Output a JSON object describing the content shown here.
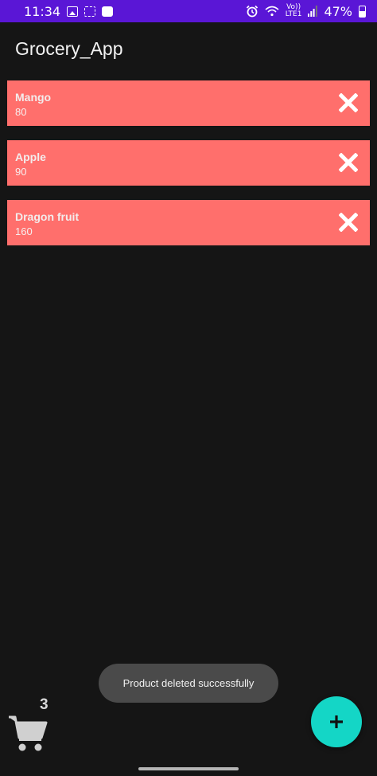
{
  "status_bar": {
    "time": "11:34",
    "volte_top": "Vo))",
    "volte_bottom": "LTE1",
    "battery_percent": "47%",
    "battery_level": 0.47
  },
  "app": {
    "title": "Grocery_App"
  },
  "products": [
    {
      "name": "Mango",
      "price": "80"
    },
    {
      "name": "Apple",
      "price": "90"
    },
    {
      "name": "Dragon fruit",
      "price": "160"
    }
  ],
  "toast": {
    "message": "Product deleted successfully"
  },
  "cart": {
    "count": "3",
    "icon": "cart-icon"
  },
  "fab": {
    "icon": "plus-icon"
  },
  "colors": {
    "status_bar": "#5a16d6",
    "background": "#151515",
    "card": "#ff6f6c",
    "fab": "#14d6c6",
    "toast": "#4a4a4a"
  }
}
